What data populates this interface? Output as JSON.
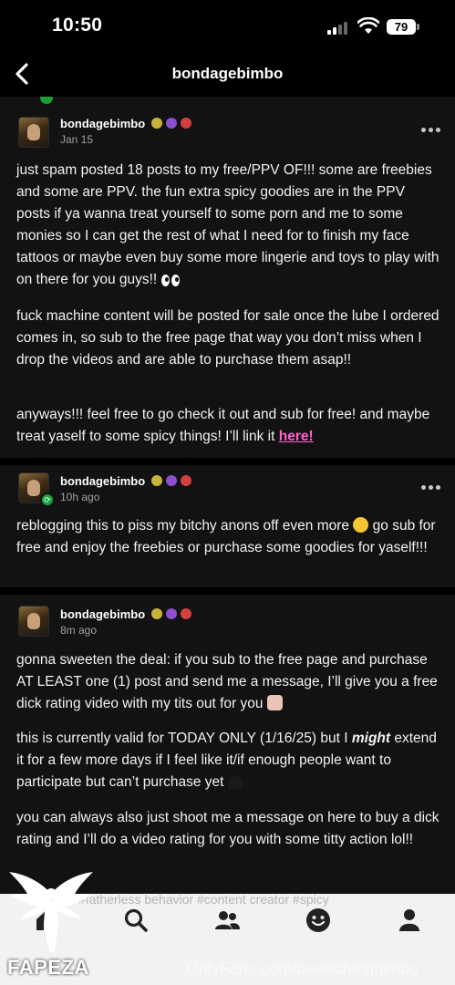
{
  "status_bar": {
    "time": "10:50",
    "battery": "79"
  },
  "nav": {
    "title": "bondagebimbo"
  },
  "posts": [
    {
      "username": "bondagebimbo",
      "timestamp": "Jan 15",
      "paragraphs": [
        "just spam posted 18 posts to my free/PPV OF!!! some are freebies and some are PPV. the fun extra spicy goodies are in the PPV posts if ya wanna treat yourself to some porn and me to some monies so I can get the rest of what I need for to finish my face tattoos or maybe even buy some more lingerie and toys to play with on there for you guys!!",
        "fuck machine content will be posted for sale once the lube I ordered comes in, so sub to the free page that way you don’t miss when I drop the videos and are able to purchase them asap!!",
        "anyways!!! feel free to go check it out and sub for free! and maybe treat yaself to some spicy things! I’ll link it"
      ],
      "link_text": "here!"
    },
    {
      "username": "bondagebimbo",
      "timestamp": "10h ago",
      "paragraphs_a": "reblogging this to piss my bitchy anons off even more",
      "paragraphs_b": "go sub for free and enjoy the freebies or purchase some goodies for yaself!!!"
    },
    {
      "username": "bondagebimbo",
      "timestamp": "8m ago",
      "p1": "gonna sweeten the deal: if you sub to the free page and purchase AT LEAST one (1) post and send me a message, I’ll give you a free dick rating video with my tits out for you",
      "p2_before": "this is currently valid for TODAY ONLY (1/16/25) but I",
      "p2_em": "might",
      "p2_after": "extend it for a few more days if I feel like it/if enough people want to participate but can’t purchase yet",
      "p3": "you can always also just shoot me a message on here to buy a dick rating and I’ll do a video rating for you with some titty action lol!!"
    }
  ],
  "tags_peek": "#fatherless behavior  #content creator  #spicy",
  "tab_bar": {
    "icons": [
      "home-icon",
      "search-icon",
      "people-icon",
      "smile-icon",
      "profile-icon"
    ]
  },
  "overlay": {
    "logo_text": "FAPEZA",
    "watermark": "OnlyFans.com/bewitchingbimbo"
  },
  "colors": {
    "link": "#ff62ce",
    "reblog_badge": "#17a33c",
    "background": "#121212"
  }
}
